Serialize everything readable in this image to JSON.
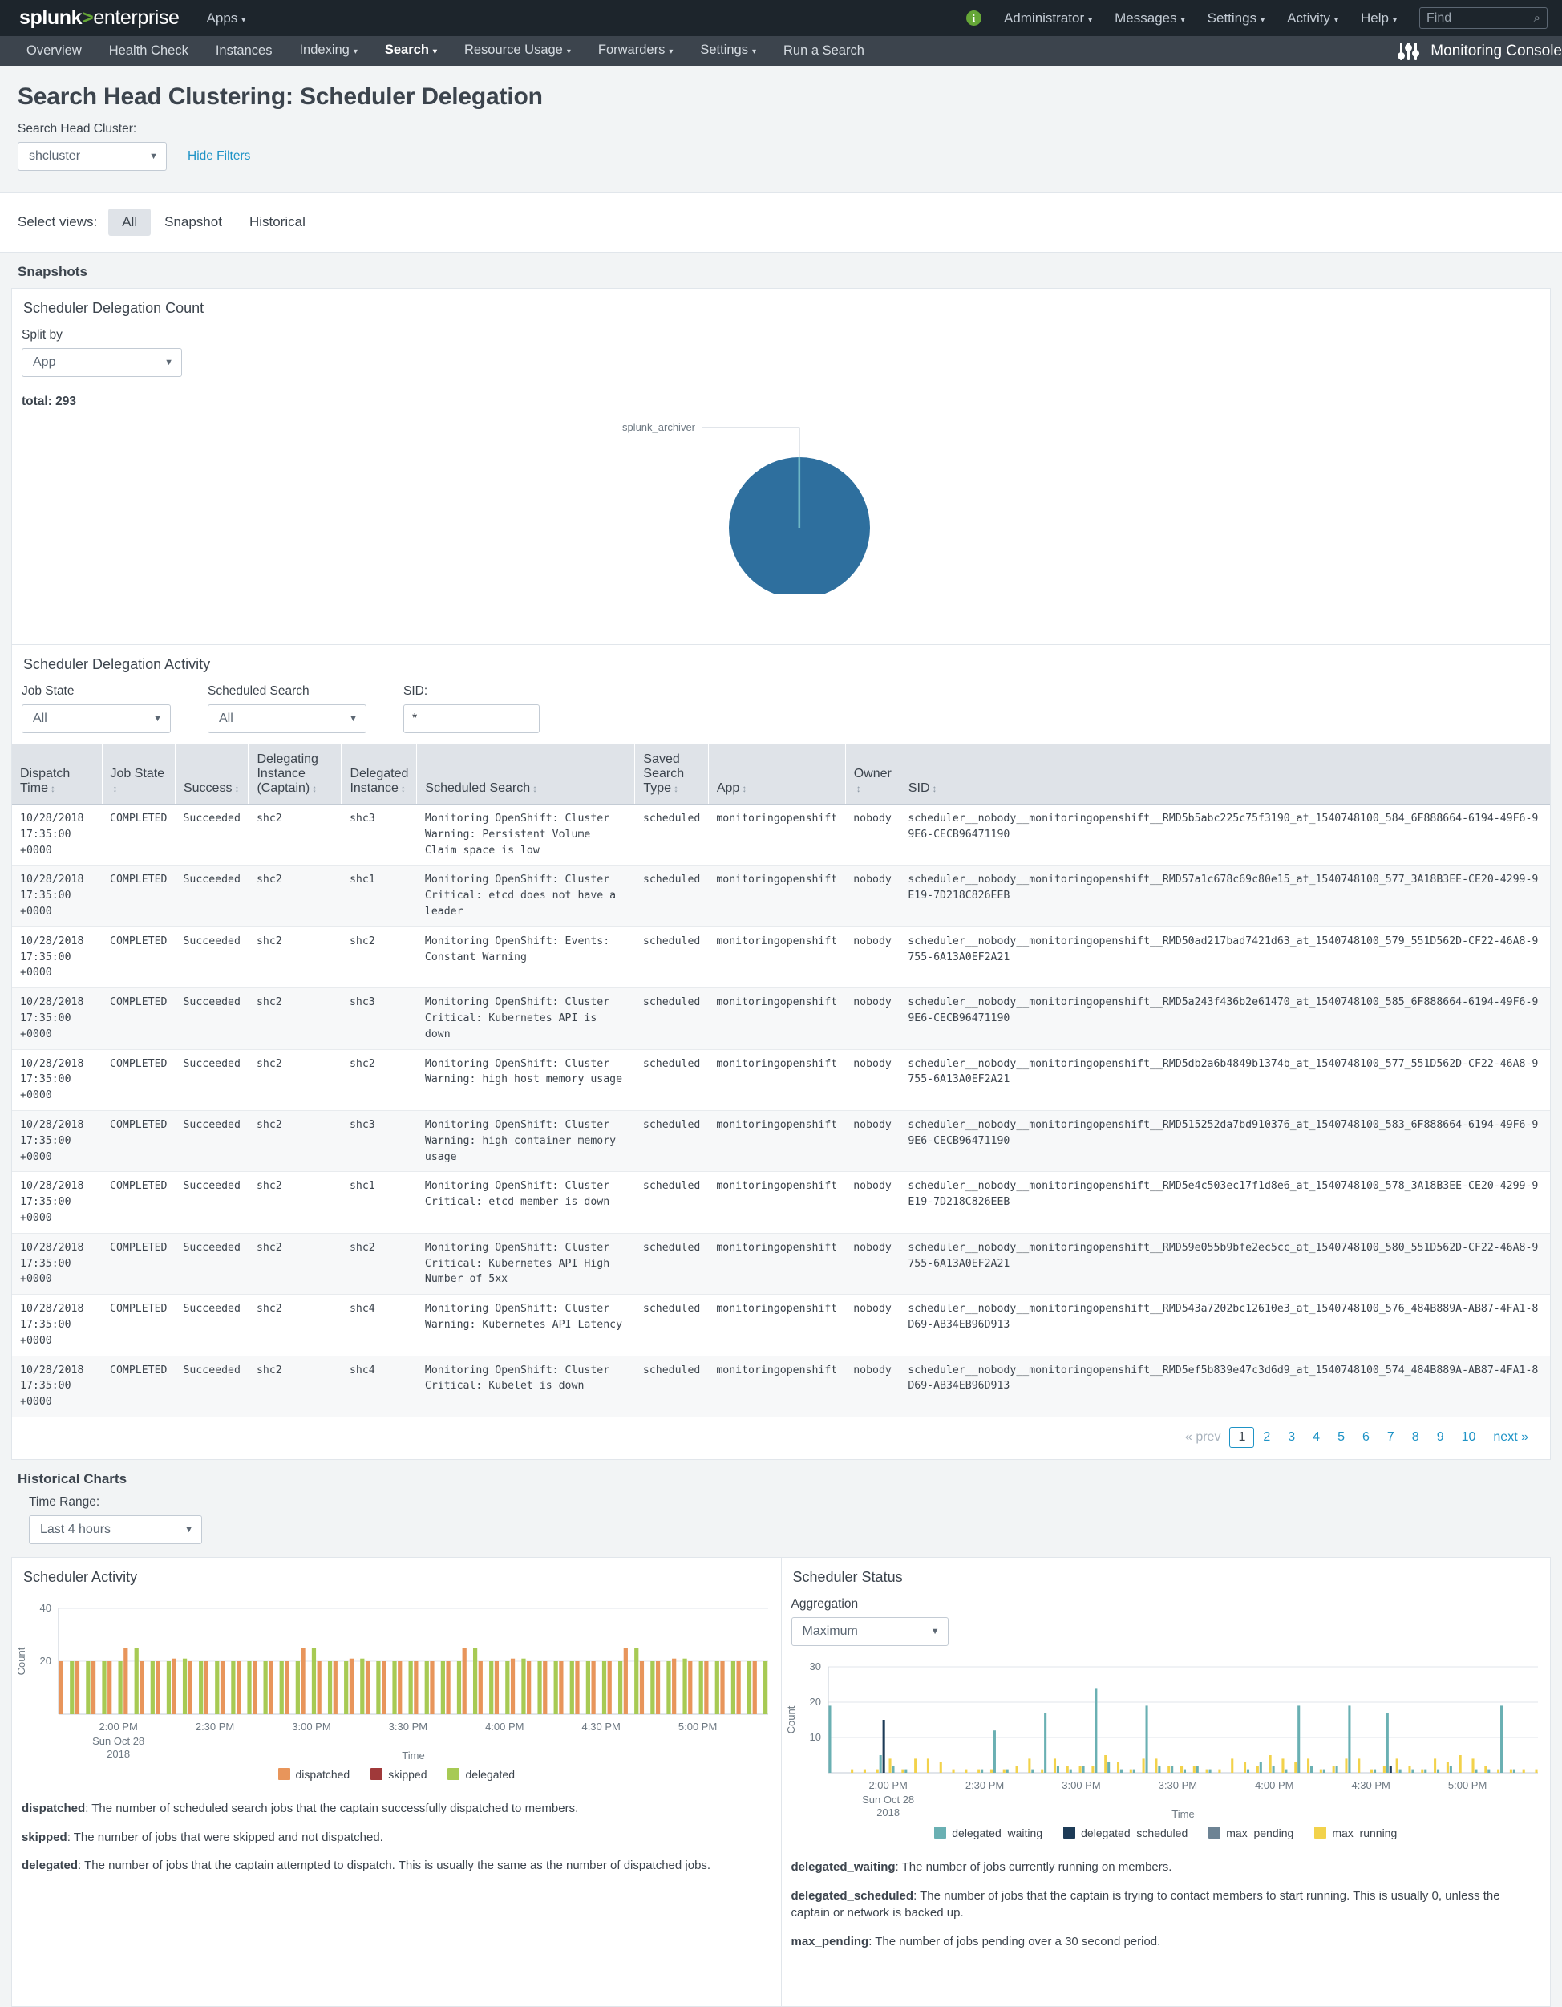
{
  "appbar": {
    "logo_word": "splunk",
    "logo_gt": ">",
    "logo_ent": "enterprise",
    "apps_label": "Apps",
    "info_glyph": "i",
    "right_items": [
      {
        "label": "Administrator",
        "caret": true
      },
      {
        "label": "Messages",
        "caret": true
      },
      {
        "label": "Settings",
        "caret": true
      },
      {
        "label": "Activity",
        "caret": true
      },
      {
        "label": "Help",
        "caret": true
      }
    ],
    "find_placeholder": "Find",
    "search_icon": "⌕"
  },
  "nav": {
    "items": [
      {
        "label": "Overview",
        "caret": false,
        "active": false
      },
      {
        "label": "Health Check",
        "caret": false,
        "active": false
      },
      {
        "label": "Instances",
        "caret": false,
        "active": false
      },
      {
        "label": "Indexing",
        "caret": true,
        "active": false
      },
      {
        "label": "Search",
        "caret": true,
        "active": true
      },
      {
        "label": "Resource Usage",
        "caret": true,
        "active": false
      },
      {
        "label": "Forwarders",
        "caret": true,
        "active": false
      },
      {
        "label": "Settings",
        "caret": true,
        "active": false
      },
      {
        "label": "Run a Search",
        "caret": false,
        "active": false
      }
    ],
    "app_name": "Monitoring Console"
  },
  "page": {
    "title": "Search Head Clustering: Scheduler Delegation",
    "cluster_label": "Search Head Cluster:",
    "cluster_value": "shcluster",
    "hide_filters": "Hide Filters",
    "views_label": "Select views:",
    "views": [
      {
        "label": "All",
        "active": true
      },
      {
        "label": "Snapshot",
        "active": false
      },
      {
        "label": "Historical",
        "active": false
      }
    ],
    "snapshots_heading": "Snapshots",
    "historical_heading": "Historical Charts"
  },
  "delegation_count": {
    "title": "Scheduler Delegation Count",
    "split_label": "Split by",
    "split_value": "App",
    "total_label": "total: 293"
  },
  "activity": {
    "title": "Scheduler Delegation Activity",
    "filters": [
      {
        "label": "Job State",
        "value": "All",
        "type": "select"
      },
      {
        "label": "Scheduled Search",
        "value": "All",
        "type": "select"
      },
      {
        "label": "SID:",
        "value": "*",
        "type": "text"
      }
    ],
    "columns": [
      "Dispatch Time",
      "Job State",
      "Success",
      "Delegating Instance (Captain)",
      "Delegated Instance",
      "Scheduled Search",
      "Saved Search Type",
      "App",
      "Owner",
      "SID"
    ],
    "rows": [
      {
        "dispatch_time": "10/28/2018 17:35:00 +0000",
        "job_state": "COMPLETED",
        "success": "Succeeded",
        "delegating": "shc2",
        "delegated": "shc3",
        "scheduled_search": "Monitoring OpenShift: Cluster Warning: Persistent Volume Claim space is low",
        "type": "scheduled",
        "app": "monitoringopenshift",
        "owner": "nobody",
        "sid": "scheduler__nobody__monitoringopenshift__RMD5b5abc225c75f3190_at_1540748100_584_6F888664-6194-49F6-99E6-CECB96471190"
      },
      {
        "dispatch_time": "10/28/2018 17:35:00 +0000",
        "job_state": "COMPLETED",
        "success": "Succeeded",
        "delegating": "shc2",
        "delegated": "shc1",
        "scheduled_search": "Monitoring OpenShift: Cluster Critical: etcd does not have a leader",
        "type": "scheduled",
        "app": "monitoringopenshift",
        "owner": "nobody",
        "sid": "scheduler__nobody__monitoringopenshift__RMD57a1c678c69c80e15_at_1540748100_577_3A18B3EE-CE20-4299-9E19-7D218C826EEB"
      },
      {
        "dispatch_time": "10/28/2018 17:35:00 +0000",
        "job_state": "COMPLETED",
        "success": "Succeeded",
        "delegating": "shc2",
        "delegated": "shc2",
        "scheduled_search": "Monitoring OpenShift: Events: Constant Warning",
        "type": "scheduled",
        "app": "monitoringopenshift",
        "owner": "nobody",
        "sid": "scheduler__nobody__monitoringopenshift__RMD50ad217bad7421d63_at_1540748100_579_551D562D-CF22-46A8-9755-6A13A0EF2A21"
      },
      {
        "dispatch_time": "10/28/2018 17:35:00 +0000",
        "job_state": "COMPLETED",
        "success": "Succeeded",
        "delegating": "shc2",
        "delegated": "shc3",
        "scheduled_search": "Monitoring OpenShift: Cluster Critical: Kubernetes API is down",
        "type": "scheduled",
        "app": "monitoringopenshift",
        "owner": "nobody",
        "sid": "scheduler__nobody__monitoringopenshift__RMD5a243f436b2e61470_at_1540748100_585_6F888664-6194-49F6-99E6-CECB96471190"
      },
      {
        "dispatch_time": "10/28/2018 17:35:00 +0000",
        "job_state": "COMPLETED",
        "success": "Succeeded",
        "delegating": "shc2",
        "delegated": "shc2",
        "scheduled_search": "Monitoring OpenShift: Cluster Warning: high host memory usage",
        "type": "scheduled",
        "app": "monitoringopenshift",
        "owner": "nobody",
        "sid": "scheduler__nobody__monitoringopenshift__RMD5db2a6b4849b1374b_at_1540748100_577_551D562D-CF22-46A8-9755-6A13A0EF2A21"
      },
      {
        "dispatch_time": "10/28/2018 17:35:00 +0000",
        "job_state": "COMPLETED",
        "success": "Succeeded",
        "delegating": "shc2",
        "delegated": "shc3",
        "scheduled_search": "Monitoring OpenShift: Cluster Warning: high container memory usage",
        "type": "scheduled",
        "app": "monitoringopenshift",
        "owner": "nobody",
        "sid": "scheduler__nobody__monitoringopenshift__RMD515252da7bd910376_at_1540748100_583_6F888664-6194-49F6-99E6-CECB96471190"
      },
      {
        "dispatch_time": "10/28/2018 17:35:00 +0000",
        "job_state": "COMPLETED",
        "success": "Succeeded",
        "delegating": "shc2",
        "delegated": "shc1",
        "scheduled_search": "Monitoring OpenShift: Cluster Critical: etcd member is down",
        "type": "scheduled",
        "app": "monitoringopenshift",
        "owner": "nobody",
        "sid": "scheduler__nobody__monitoringopenshift__RMD5e4c503ec17f1d8e6_at_1540748100_578_3A18B3EE-CE20-4299-9E19-7D218C826EEB"
      },
      {
        "dispatch_time": "10/28/2018 17:35:00 +0000",
        "job_state": "COMPLETED",
        "success": "Succeeded",
        "delegating": "shc2",
        "delegated": "shc2",
        "scheduled_search": "Monitoring OpenShift: Cluster Critical: Kubernetes API High Number of 5xx",
        "type": "scheduled",
        "app": "monitoringopenshift",
        "owner": "nobody",
        "sid": "scheduler__nobody__monitoringopenshift__RMD59e055b9bfe2ec5cc_at_1540748100_580_551D562D-CF22-46A8-9755-6A13A0EF2A21"
      },
      {
        "dispatch_time": "10/28/2018 17:35:00 +0000",
        "job_state": "COMPLETED",
        "success": "Succeeded",
        "delegating": "shc2",
        "delegated": "shc4",
        "scheduled_search": "Monitoring OpenShift: Cluster Warning: Kubernetes API Latency",
        "type": "scheduled",
        "app": "monitoringopenshift",
        "owner": "nobody",
        "sid": "scheduler__nobody__monitoringopenshift__RMD543a7202bc12610e3_at_1540748100_576_484B889A-AB87-4FA1-8D69-AB34EB96D913"
      },
      {
        "dispatch_time": "10/28/2018 17:35:00 +0000",
        "job_state": "COMPLETED",
        "success": "Succeeded",
        "delegating": "shc2",
        "delegated": "shc4",
        "scheduled_search": "Monitoring OpenShift: Cluster Critical: Kubelet is down",
        "type": "scheduled",
        "app": "monitoringopenshift",
        "owner": "nobody",
        "sid": "scheduler__nobody__monitoringopenshift__RMD5ef5b839e47c3d6d9_at_1540748100_574_484B889A-AB87-4FA1-8D69-AB34EB96D913"
      }
    ],
    "pagination": {
      "prev": "« prev",
      "pages": [
        "1",
        "2",
        "3",
        "4",
        "5",
        "6",
        "7",
        "8",
        "9",
        "10"
      ],
      "current": "1",
      "next": "next »"
    }
  },
  "historical": {
    "time_range_label": "Time Range:",
    "time_range_value": "Last 4 hours",
    "activity_panel_title": "Scheduler Activity",
    "status_panel_title": "Scheduler Status",
    "aggregation_label": "Aggregation",
    "aggregation_value": "Maximum",
    "activity_desc": [
      {
        "term": "dispatched",
        "text": ": The number of scheduled search jobs that the captain successfully dispatched to members."
      },
      {
        "term": "skipped",
        "text": ": The number of jobs that were skipped and not dispatched."
      },
      {
        "term": "delegated",
        "text": ": The number of jobs that the captain attempted to dispatch. This is usually the same as the number of dispatched jobs."
      }
    ],
    "status_desc": [
      {
        "term": "delegated_waiting",
        "text": ": The number of jobs currently running on members."
      },
      {
        "term": "delegated_scheduled",
        "text": ": The number of jobs that the captain is trying to contact members to start running. This is usually 0, unless the captain or network is backed up."
      },
      {
        "term": "max_pending",
        "text": ": The number of jobs pending over a 30 second period."
      }
    ]
  },
  "colors": {
    "pie_main": "#2e6f9e",
    "pie_small": "#6db7c6",
    "dispatched": "#e8955b",
    "skipped": "#a0393a",
    "delegated": "#a7ca54",
    "delegated_waiting": "#6ab0b3",
    "delegated_scheduled": "#1d3b57",
    "max_pending": "#6d8394",
    "max_running": "#f2d24b"
  },
  "chart_data": [
    {
      "type": "pie",
      "title": "Scheduler Delegation Count",
      "total": 293,
      "labels": [
        "monitoringopenshift",
        "splunk_archiver"
      ],
      "values": [
        292,
        1
      ],
      "colors": [
        "#2e6f9e",
        "#6db7c6"
      ],
      "legend": "callout-labels"
    },
    {
      "type": "bar",
      "title": "Scheduler Activity",
      "xlabel": "Time",
      "ylabel": "Count",
      "ylim": [
        0,
        40
      ],
      "yticks": [
        20,
        40
      ],
      "grid": true,
      "xticks": [
        "2:00 PM",
        "2:30 PM",
        "3:00 PM",
        "3:30 PM",
        "4:00 PM",
        "4:30 PM",
        "5:00 PM"
      ],
      "xtick_sub": [
        "Sun Oct 28",
        "2018"
      ],
      "legend_position": "bottom",
      "series": [
        {
          "name": "dispatched",
          "color": "#e8955b",
          "values": [
            20,
            20,
            20,
            20,
            25,
            20,
            20,
            21,
            20,
            20,
            20,
            20,
            20,
            20,
            20,
            25,
            20,
            20,
            21,
            20,
            20,
            20,
            20,
            20,
            20,
            25,
            20,
            20,
            21,
            20,
            20,
            20,
            20,
            20,
            20,
            25,
            20,
            20,
            21,
            20,
            20,
            20,
            20,
            20
          ]
        },
        {
          "name": "skipped",
          "color": "#a0393a",
          "values": [
            0,
            0,
            0,
            0,
            0,
            0,
            0,
            0,
            0,
            0,
            0,
            0,
            0,
            0,
            0,
            0,
            0,
            0,
            0,
            0,
            0,
            0,
            0,
            0,
            0,
            0,
            0,
            0,
            0,
            0,
            0,
            0,
            0,
            0,
            0,
            0,
            0,
            0,
            0,
            0,
            0,
            0,
            0,
            0
          ]
        },
        {
          "name": "delegated",
          "color": "#a7ca54",
          "values": [
            20,
            20,
            20,
            20,
            25,
            20,
            20,
            21,
            20,
            20,
            20,
            20,
            20,
            20,
            20,
            25,
            20,
            20,
            21,
            20,
            20,
            20,
            20,
            20,
            20,
            25,
            20,
            20,
            21,
            20,
            20,
            20,
            20,
            20,
            20,
            25,
            20,
            20,
            21,
            20,
            20,
            20,
            20,
            20
          ]
        }
      ]
    },
    {
      "type": "bar",
      "title": "Scheduler Status",
      "xlabel": "Time",
      "ylabel": "Count",
      "ylim": [
        0,
        30
      ],
      "yticks": [
        10,
        20,
        30
      ],
      "grid": true,
      "xticks": [
        "2:00 PM",
        "2:30 PM",
        "3:00 PM",
        "3:30 PM",
        "4:00 PM",
        "4:30 PM",
        "5:00 PM"
      ],
      "xtick_sub": [
        "Sun Oct 28",
        "2018"
      ],
      "legend_position": "bottom",
      "series": [
        {
          "name": "delegated_waiting",
          "color": "#6ab0b3",
          "values": [
            19,
            0,
            0,
            0,
            5,
            2,
            1,
            0,
            0,
            0,
            0,
            0,
            1,
            12,
            1,
            0,
            1,
            17,
            2,
            1,
            2,
            24,
            3,
            1,
            1,
            19,
            2,
            2,
            1,
            2,
            1,
            0,
            0,
            1,
            3,
            2,
            1,
            19,
            2,
            1,
            2,
            19,
            0,
            1,
            17,
            1,
            1,
            1,
            1,
            2,
            0,
            1,
            1,
            19,
            1,
            0
          ]
        },
        {
          "name": "delegated_scheduled",
          "color": "#1d3b57",
          "values": [
            0,
            0,
            0,
            0,
            15,
            0,
            0,
            0,
            0,
            0,
            0,
            0,
            0,
            0,
            0,
            0,
            0,
            0,
            0,
            0,
            0,
            0,
            0,
            0,
            0,
            0,
            0,
            0,
            0,
            0,
            0,
            0,
            0,
            0,
            0,
            0,
            0,
            0,
            0,
            0,
            0,
            0,
            0,
            0,
            2,
            0,
            0,
            0,
            0,
            0,
            0,
            0,
            0,
            0,
            0,
            0
          ]
        },
        {
          "name": "max_pending",
          "color": "#6d8394",
          "values": [
            0,
            0,
            0,
            0,
            0,
            0,
            0,
            0,
            0,
            0,
            0,
            0,
            0,
            0,
            0,
            0,
            0,
            0,
            0,
            0,
            0,
            0,
            0,
            0,
            0,
            0,
            0,
            0,
            0,
            0,
            0,
            0,
            0,
            0,
            0,
            0,
            0,
            0,
            0,
            0,
            0,
            0,
            0,
            0,
            0,
            0,
            0,
            0,
            0,
            0,
            0,
            0,
            0,
            0,
            0,
            0
          ]
        },
        {
          "name": "max_running",
          "color": "#f2d24b",
          "values": [
            0,
            1,
            1,
            1,
            4,
            1,
            4,
            4,
            3,
            1,
            1,
            1,
            1,
            1,
            2,
            4,
            1,
            4,
            2,
            2,
            2,
            5,
            3,
            1,
            4,
            4,
            2,
            2,
            2,
            1,
            1,
            4,
            3,
            2,
            5,
            4,
            3,
            4,
            1,
            2,
            4,
            4,
            1,
            2,
            4,
            2,
            1,
            4,
            3,
            5,
            4,
            2,
            1,
            1,
            1,
            1
          ]
        }
      ]
    }
  ]
}
